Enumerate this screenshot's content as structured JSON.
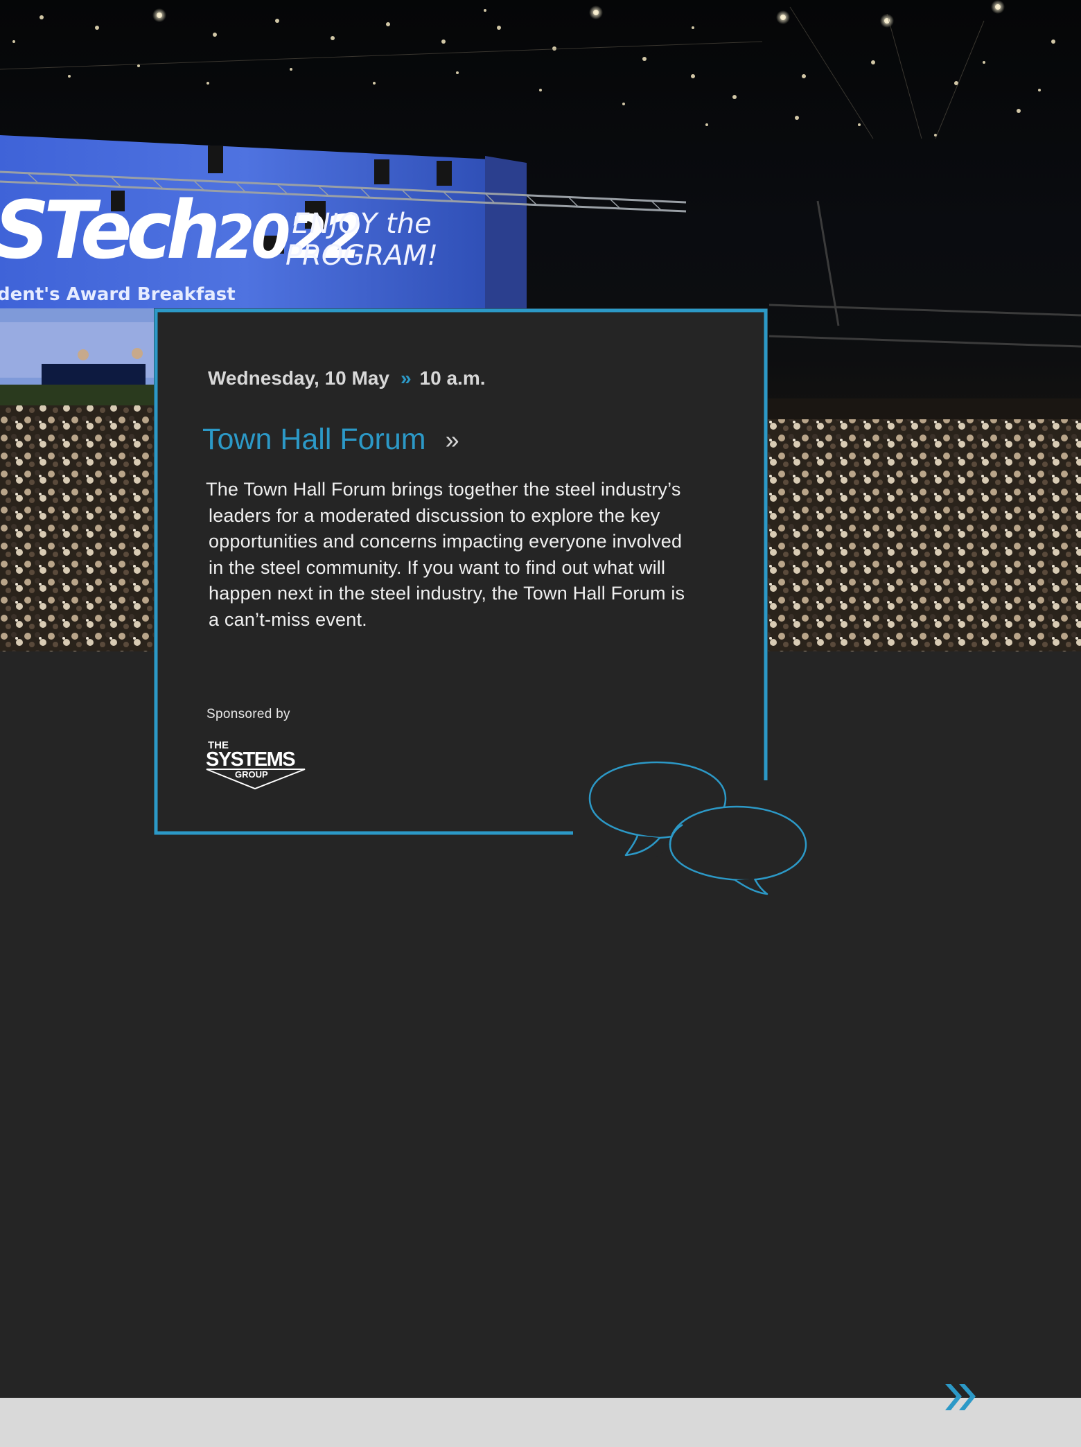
{
  "hero": {
    "banner_logo_text": "STech2022",
    "banner_logo_main": "STech",
    "banner_logo_year": "2022",
    "banner_tagline_1": "ENJOY the",
    "banner_tagline_2": "PROGRAM!",
    "banner_subtitle": "dent's Award Breakfast"
  },
  "event": {
    "date": "Wednesday, 10 May",
    "separator": "»",
    "time": "10 a.m.",
    "title": "Town Hall Forum",
    "title_arrow": "»",
    "description_lines": [
      "The Town Hall Forum brings together the steel industry’s",
      "leaders for a moderated discussion to explore the key",
      "opportunities and concerns impacting everyone involved",
      "in the steel community. If you want to find out what will",
      "happen next in the steel industry, the Town Hall Forum is",
      "a can’t-miss event."
    ]
  },
  "sponsor": {
    "label": "Sponsored by",
    "logo_the": "THE",
    "logo_main": "SYSTEMS",
    "logo_group": "GROUP"
  },
  "colors": {
    "accent": "#2c99c7",
    "background": "#252525",
    "footer": "#d9d9d9"
  },
  "icons": {
    "speech_bubbles": "speech-bubbles-icon",
    "next_page": "double-chevron-right-icon"
  }
}
